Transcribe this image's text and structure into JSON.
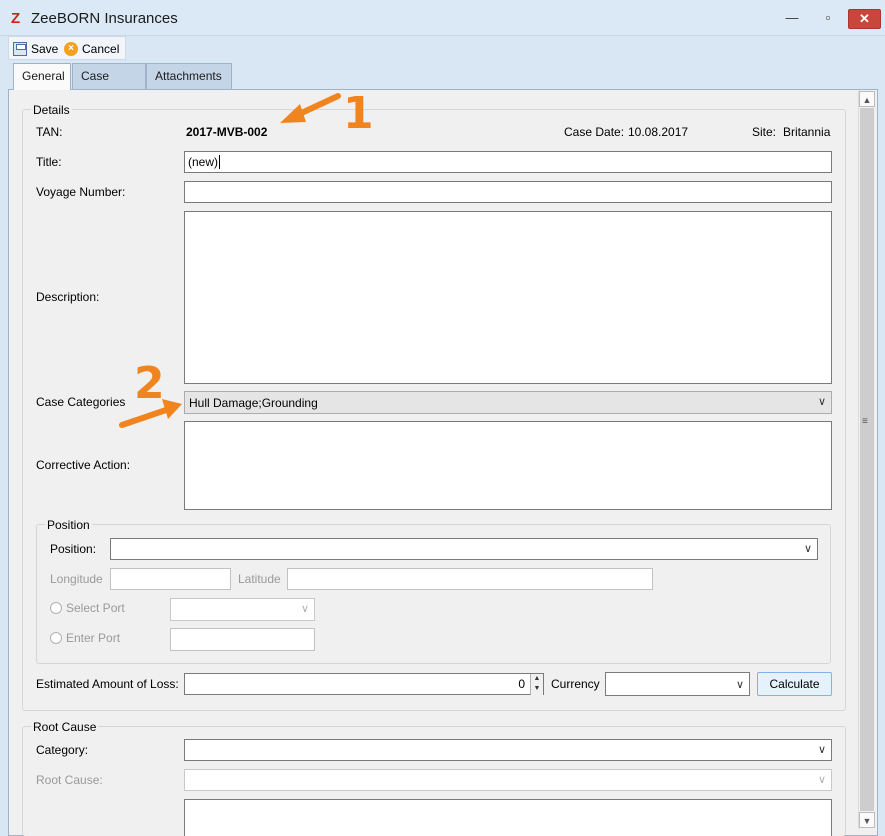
{
  "window": {
    "title": "ZeeBORN Insurances",
    "logo_letter": "Z",
    "minimize": "—",
    "maximize": "▫",
    "close": "✕"
  },
  "toolbar": {
    "save_label": "Save",
    "cancel_label": "Cancel"
  },
  "tabs": [
    {
      "label": "General",
      "active": true
    },
    {
      "label": "Case Items",
      "active": false
    },
    {
      "label": "Attachments",
      "active": false
    }
  ],
  "details": {
    "group_title": "Details",
    "tan_label": "TAN:",
    "tan_value": "2017-MVB-002",
    "case_date_label": "Case Date:",
    "case_date_value": "10.08.2017",
    "site_label": "Site:",
    "site_value": "Britannia",
    "title_label": "Title:",
    "title_value": "(new)",
    "voyage_label": "Voyage Number:",
    "voyage_value": "",
    "description_label": "Description:",
    "description_value": "",
    "case_categories_label": "Case Categories",
    "case_categories_value": "Hull Damage;Grounding",
    "corrective_action_label": "Corrective Action:",
    "corrective_action_value": ""
  },
  "position": {
    "group_title": "Position",
    "position_label": "Position:",
    "position_value": "",
    "longitude_label": "Longitude",
    "longitude_value": "",
    "latitude_label": "Latitude",
    "latitude_value": "",
    "select_port_label": "Select Port",
    "select_port_value": "",
    "enter_port_label": "Enter Port",
    "enter_port_value": ""
  },
  "loss": {
    "estimated_label": "Estimated Amount of Loss:",
    "estimated_value": "0",
    "currency_label": "Currency",
    "currency_value": "",
    "calculate_label": "Calculate"
  },
  "root_cause": {
    "group_title": "Root Cause",
    "category_label": "Category:",
    "category_value": "",
    "root_cause_label": "Root Cause:",
    "root_cause_value": ""
  },
  "annotations": {
    "marker_1": "1",
    "marker_2": "2"
  },
  "colors": {
    "accent_orange": "#f0841f",
    "close_red": "#c9463d",
    "logo_red": "#d11f1f"
  },
  "icons": {
    "save": "save-icon",
    "cancel": "cancel-icon",
    "chevron": "chevron-down-icon"
  }
}
